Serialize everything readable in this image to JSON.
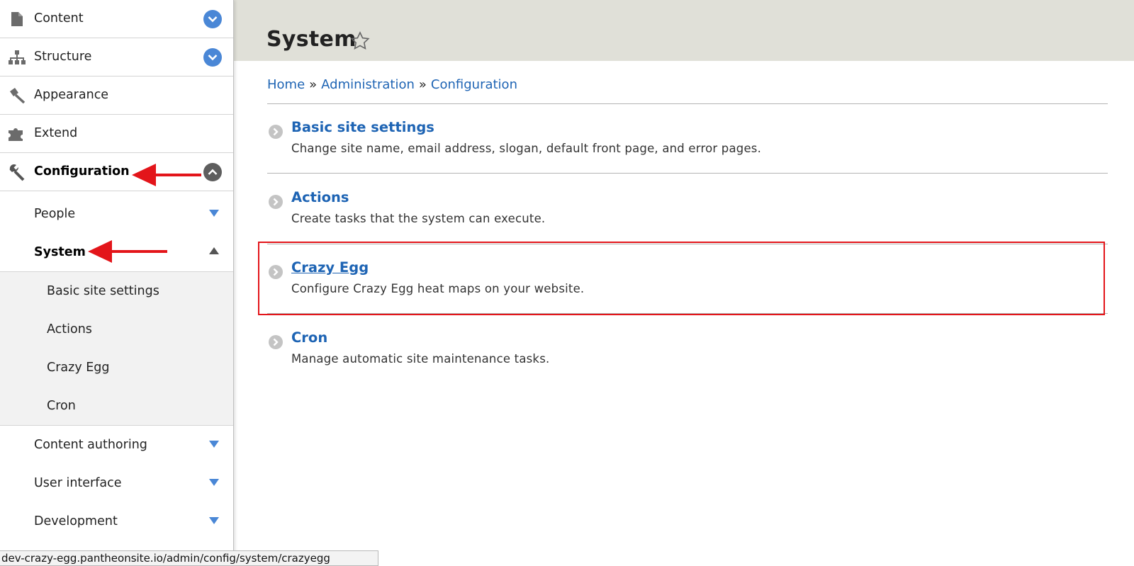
{
  "sidebar": {
    "items": [
      {
        "label": "Content",
        "icon": "document-icon"
      },
      {
        "label": "Structure",
        "icon": "sitemap-icon"
      },
      {
        "label": "Appearance",
        "icon": "paintbrush-icon"
      },
      {
        "label": "Extend",
        "icon": "puzzle-icon"
      },
      {
        "label": "Configuration",
        "icon": "wrench-icon"
      }
    ],
    "config_children": [
      {
        "label": "People"
      },
      {
        "label": "System"
      }
    ],
    "system_children": [
      {
        "label": "Basic site settings"
      },
      {
        "label": "Actions"
      },
      {
        "label": "Crazy Egg"
      },
      {
        "label": "Cron"
      }
    ],
    "more_children": [
      {
        "label": "Content authoring"
      },
      {
        "label": "User interface"
      },
      {
        "label": "Development"
      }
    ]
  },
  "header": {
    "title": "System"
  },
  "breadcrumb": {
    "home": "Home",
    "administration": "Administration",
    "configuration": "Configuration",
    "separator": "»"
  },
  "entries": [
    {
      "title": "Basic site settings",
      "description": "Change site name, email address, slogan, default front page, and error pages."
    },
    {
      "title": "Actions",
      "description": "Create tasks that the system can execute."
    },
    {
      "title": "Crazy Egg",
      "description": "Configure Crazy Egg heat maps on your website."
    },
    {
      "title": "Cron",
      "description": "Manage automatic site maintenance tasks."
    }
  ],
  "status_bar": {
    "url": "dev-crazy-egg.pantheonsite.io/admin/config/system/crazyegg"
  },
  "colors": {
    "link": "#1e64b4",
    "toggle_blue": "#4a87d6",
    "annotation_red": "#e3151a",
    "header_bg": "#e0e0d8"
  }
}
